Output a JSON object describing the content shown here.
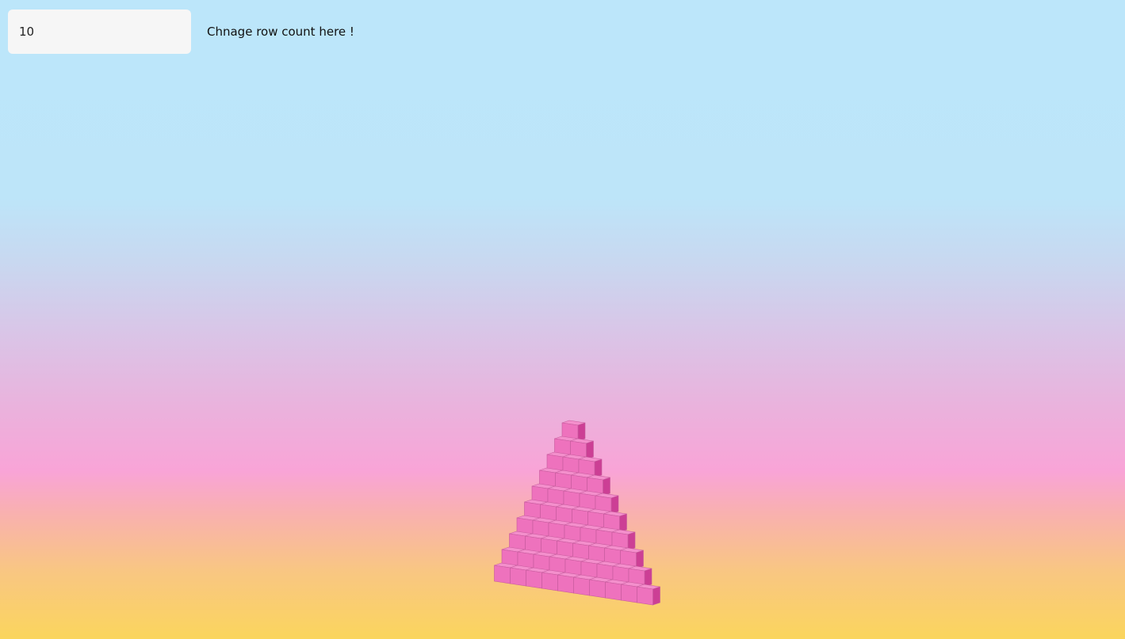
{
  "row_count": {
    "value": "10",
    "rows": 10
  },
  "hint": {
    "text": "Chnage row count here !"
  },
  "colors": {
    "cube_front": "#ee72bd",
    "cube_top": "#f48fcc",
    "cube_side": "#cc3f95",
    "cube_edge": "#c55a9c"
  }
}
